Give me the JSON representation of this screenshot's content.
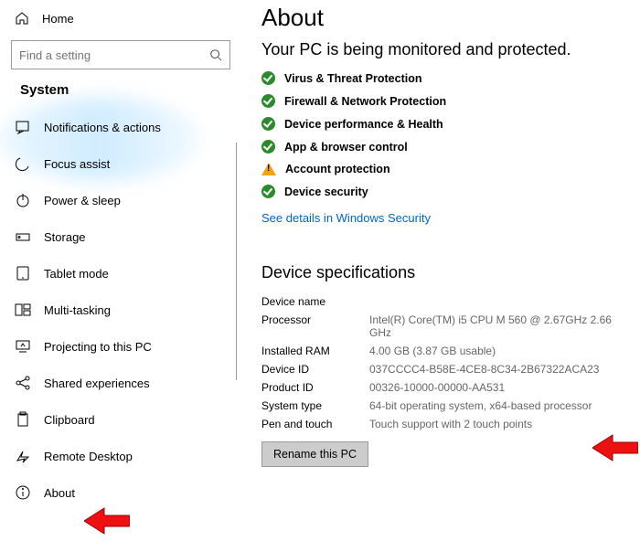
{
  "sidebar": {
    "home": "Home",
    "search_placeholder": "Find a setting",
    "section": "System",
    "items": [
      {
        "label": "Notifications & actions"
      },
      {
        "label": "Focus assist"
      },
      {
        "label": "Power & sleep"
      },
      {
        "label": "Storage"
      },
      {
        "label": "Tablet mode"
      },
      {
        "label": "Multi-tasking"
      },
      {
        "label": "Projecting to this PC"
      },
      {
        "label": "Shared experiences"
      },
      {
        "label": "Clipboard"
      },
      {
        "label": "Remote Desktop"
      },
      {
        "label": "About"
      }
    ]
  },
  "main": {
    "title": "About",
    "monitored": "Your PC is being monitored and protected.",
    "status": [
      {
        "type": "ok",
        "label": "Virus & Threat Protection"
      },
      {
        "type": "ok",
        "label": "Firewall & Network Protection"
      },
      {
        "type": "ok",
        "label": "Device performance & Health"
      },
      {
        "type": "ok",
        "label": "App & browser control"
      },
      {
        "type": "warn",
        "label": "Account protection"
      },
      {
        "type": "ok",
        "label": "Device security"
      }
    ],
    "security_link": "See details in Windows Security",
    "spec_title": "Device specifications",
    "specs": {
      "device_name_label": "Device name",
      "device_name_value": "",
      "processor_label": "Processor",
      "processor_value": "Intel(R) Core(TM) i5 CPU       M 560  @ 2.67GHz   2.66 GHz",
      "ram_label": "Installed RAM",
      "ram_value": "4.00 GB (3.87 GB usable)",
      "deviceid_label": "Device ID",
      "deviceid_value": "037CCCC4-B58E-4CE8-8C34-2B67322ACA23",
      "productid_label": "Product ID",
      "productid_value": "00326-10000-00000-AA531",
      "systype_label": "System type",
      "systype_value": "64-bit operating system, x64-based processor",
      "pen_label": "Pen and touch",
      "pen_value": "Touch support with 2 touch points"
    },
    "rename_button": "Rename this PC"
  }
}
